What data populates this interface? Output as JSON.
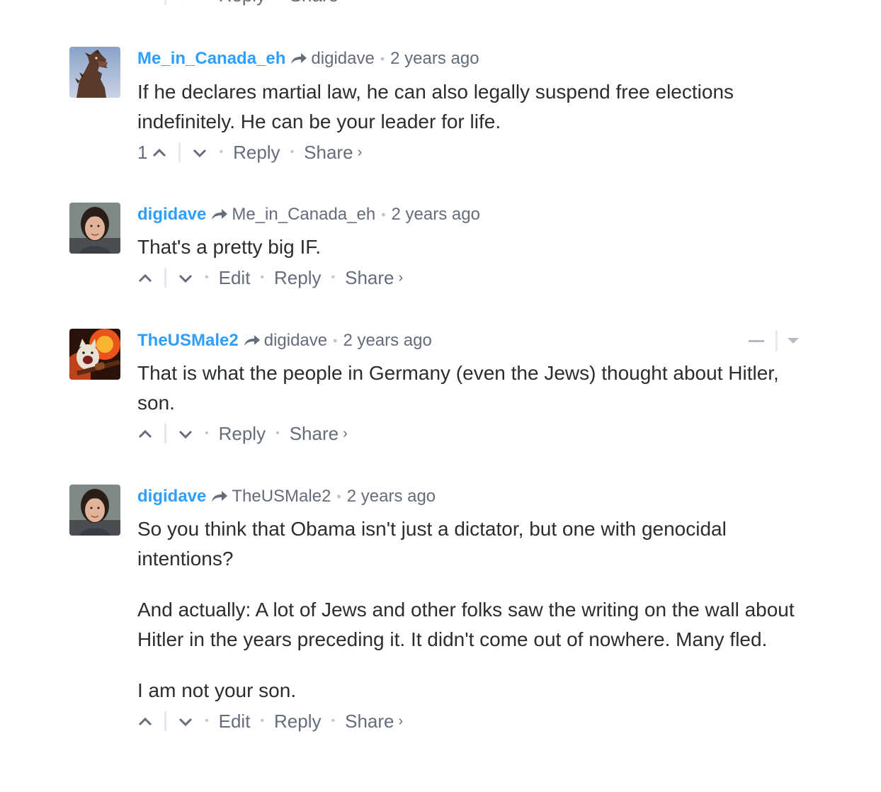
{
  "previous_comment_actions": {
    "reply_label": "Reply",
    "share_label": "Share"
  },
  "comments": [
    {
      "author": "Me_in_Canada_eh",
      "parent": "digidave",
      "time": "2 years ago",
      "paragraphs": [
        "If he declares martial law, he can also legally suspend free elections indefinitely. He can be your leader for life."
      ],
      "votes": "1",
      "reply_label": "Reply",
      "share_label": "Share",
      "avatar_icon": "godzilla-avatar-icon"
    },
    {
      "author": "digidave",
      "parent": "Me_in_Canada_eh",
      "time": "2 years ago",
      "paragraphs": [
        "That's a pretty big IF."
      ],
      "edit_label": "Edit",
      "reply_label": "Reply",
      "share_label": "Share",
      "avatar_icon": "user-photo-avatar-icon"
    },
    {
      "author": "TheUSMale2",
      "parent": "digidave",
      "time": "2 years ago",
      "paragraphs": [
        "That is what the people in Germany (even the Jews) thought about Hitler, son."
      ],
      "reply_label": "Reply",
      "share_label": "Share",
      "avatar_icon": "cat-guitar-avatar-icon"
    },
    {
      "author": "digidave",
      "parent": "TheUSMale2",
      "time": "2 years ago",
      "paragraphs": [
        "So you think that Obama isn't just a dictator, but one with genocidal intentions?",
        "And actually: A lot of Jews and other folks saw the writing on the wall about Hitler in the years preceding it. It didn't come out of nowhere. Many fled.",
        "I am not your son."
      ],
      "edit_label": "Edit",
      "reply_label": "Reply",
      "share_label": "Share",
      "avatar_icon": "user-photo-avatar-icon"
    }
  ],
  "colors": {
    "author": "#2e9fff",
    "meta": "#656c7a",
    "text": "#2a2e2e",
    "separator": "#e7e9ee"
  }
}
